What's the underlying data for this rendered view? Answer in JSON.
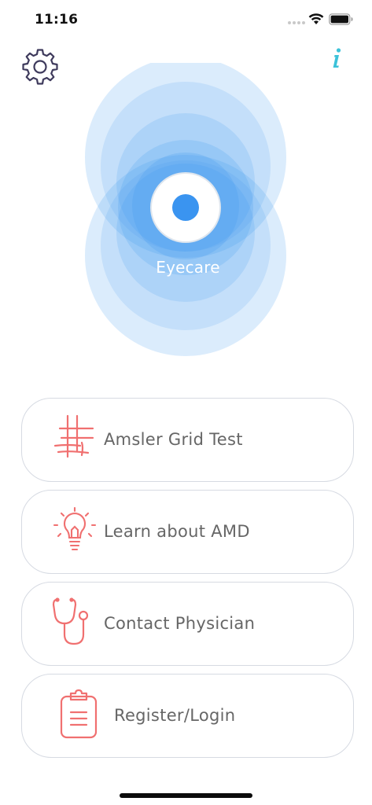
{
  "status_bar": {
    "time": "11:16",
    "wifi_icon": "wifi-icon",
    "battery_icon": "battery-icon"
  },
  "header": {
    "settings_icon": "gear-icon",
    "info_icon": "info-icon",
    "info_label": "i"
  },
  "logo": {
    "label": "Eyecare",
    "colors": {
      "outer_ring": "#d5e7fb",
      "mid_ring": "#a9d0f8",
      "core": "#4a9cf0",
      "pupil": "#3a94f0"
    }
  },
  "menu": {
    "items": [
      {
        "label": "Amsler Grid Test",
        "icon": "grid-icon"
      },
      {
        "label": "Learn about AMD",
        "icon": "lightbulb-icon"
      },
      {
        "label": "Contact Physician",
        "icon": "stethoscope-icon"
      },
      {
        "label": "Register/Login",
        "icon": "clipboard-icon"
      }
    ]
  },
  "colors": {
    "accent_icon": "#f07070",
    "info_accent": "#3cc2d9",
    "settings_icon": "#3e3a5c",
    "card_border": "#d6dae2",
    "label_text": "#666666"
  }
}
